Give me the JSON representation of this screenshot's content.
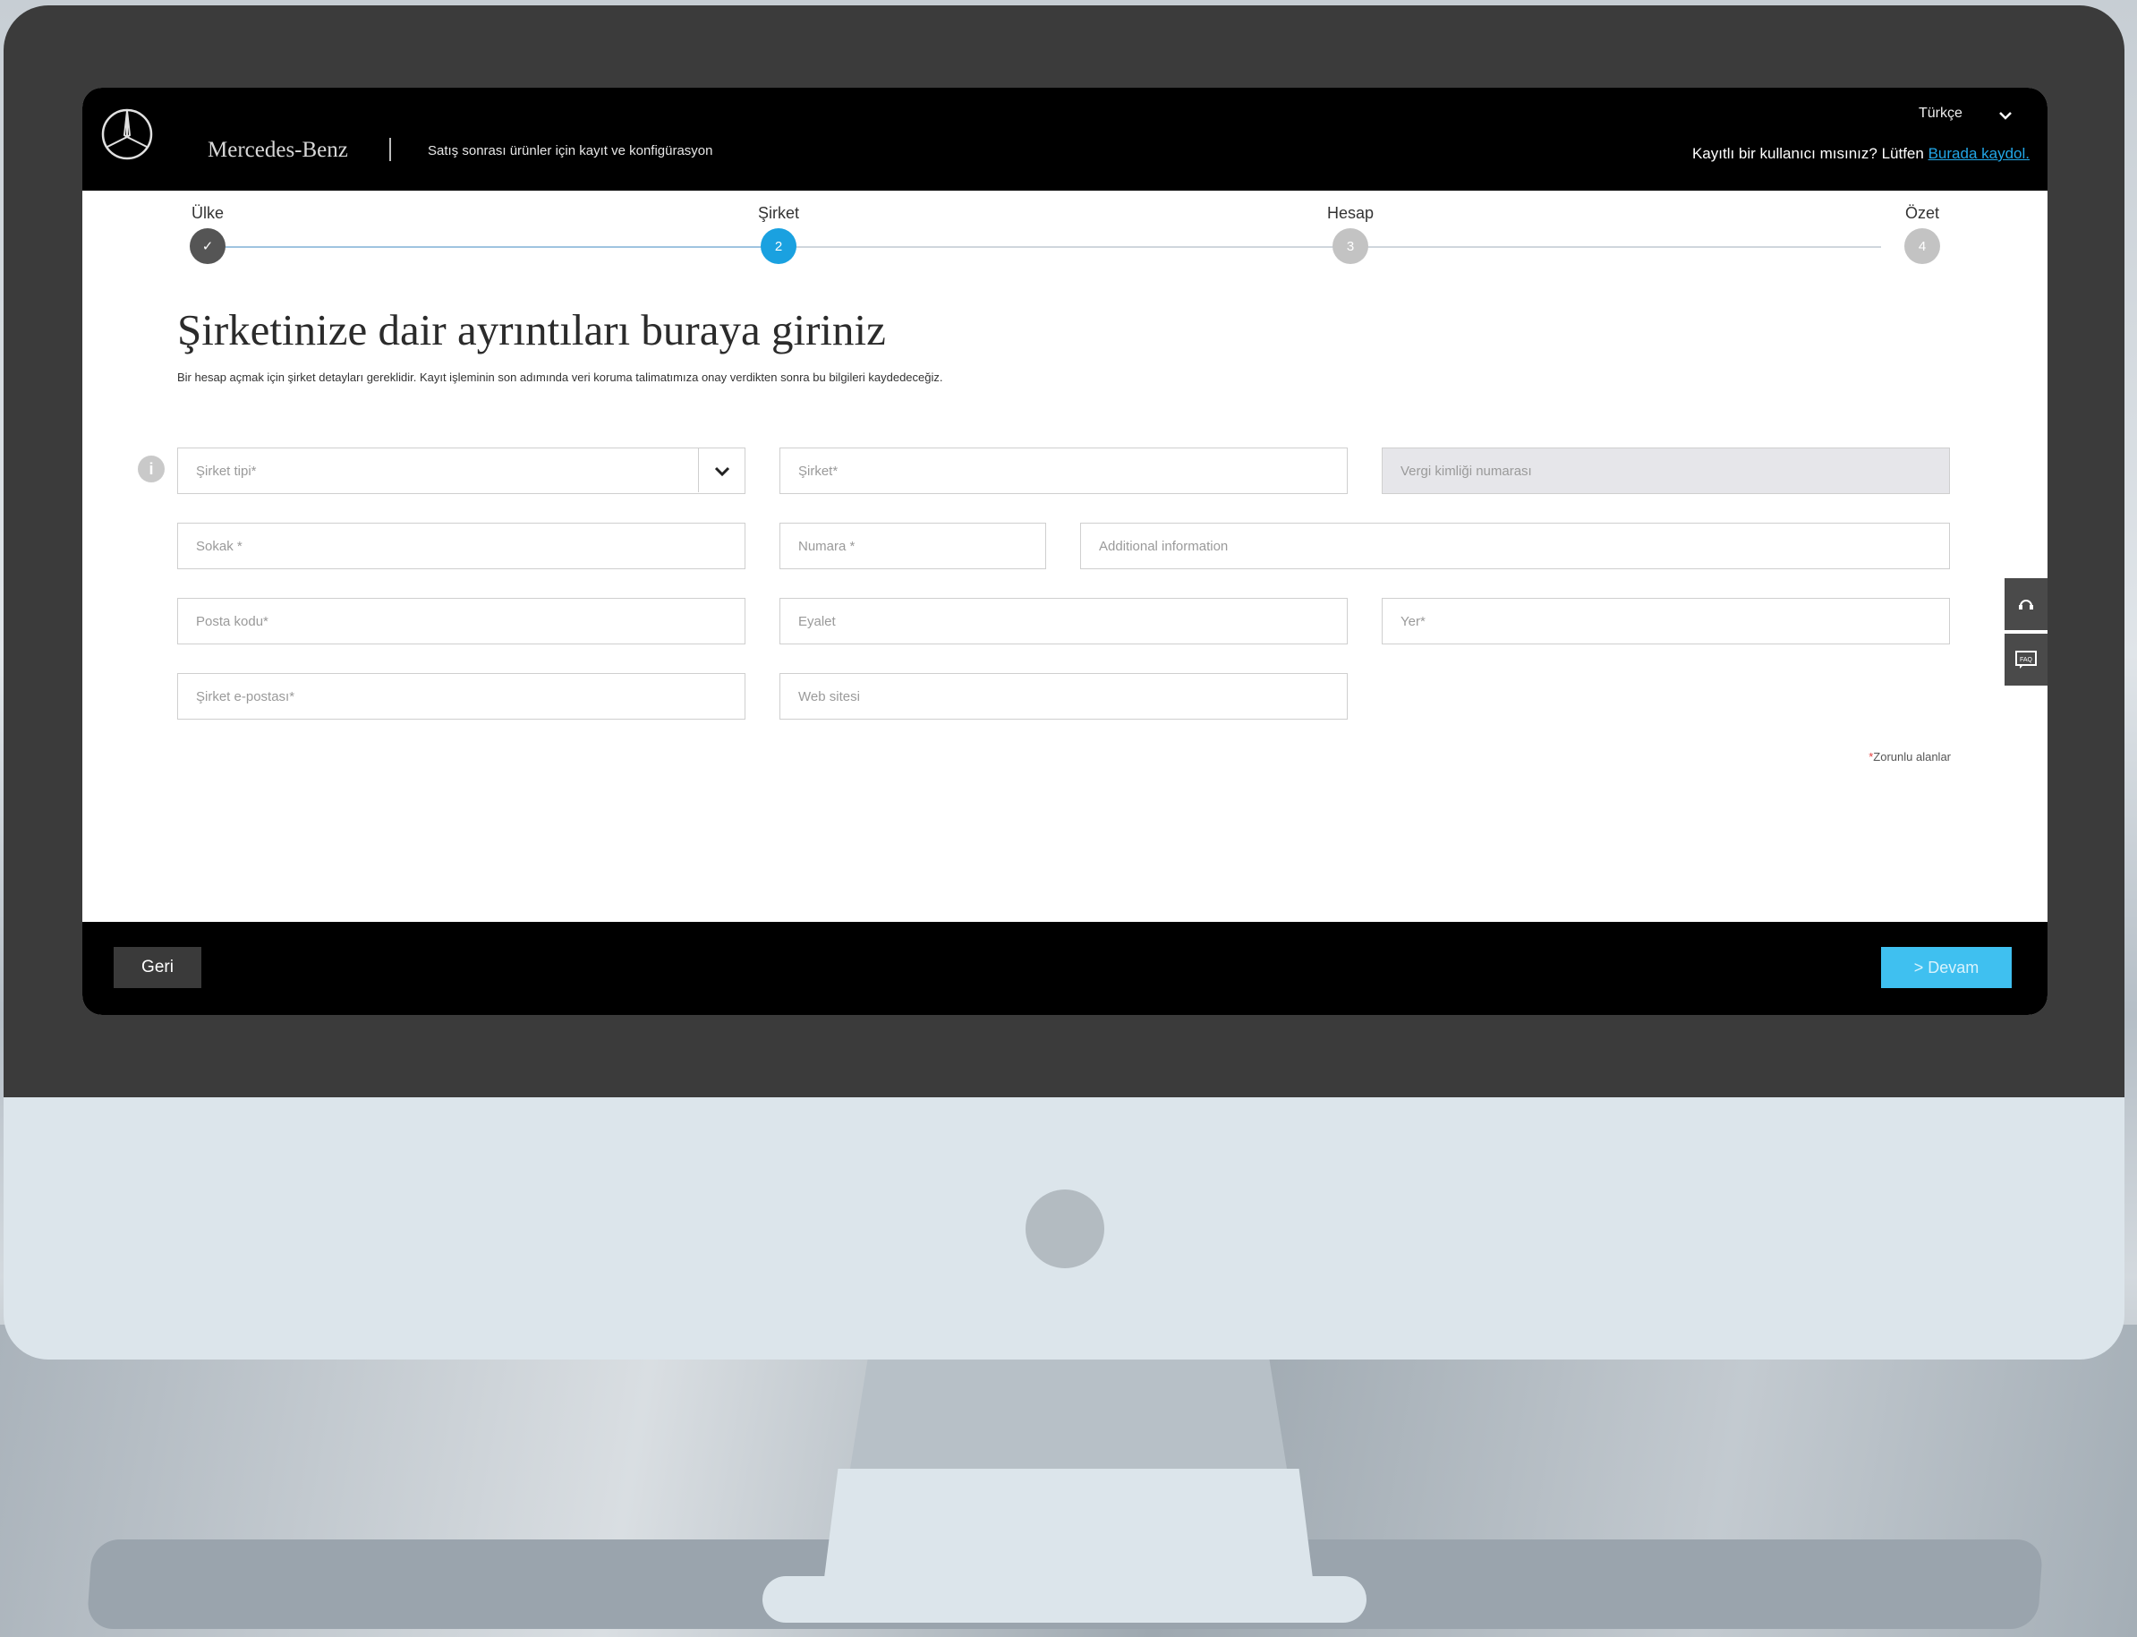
{
  "header": {
    "brand": "Mercedes-Benz",
    "subtitle": "Satış sonrası ürünler için kayıt ve konfigürasyon",
    "language": "Türkçe",
    "register_prompt": "Kayıtlı bir kullanıcı mısınız? Lütfen",
    "register_link": "Burada kaydol."
  },
  "stepper": {
    "steps": [
      {
        "label": "Ülke",
        "marker": "✓",
        "state": "done"
      },
      {
        "label": "Şirket",
        "marker": "2",
        "state": "active"
      },
      {
        "label": "Hesap",
        "marker": "3",
        "state": "todo"
      },
      {
        "label": "Özet",
        "marker": "4",
        "state": "todo"
      }
    ]
  },
  "main": {
    "title": "Şirketinize dair ayrıntıları buraya giriniz",
    "description": "Bir hesap açmak için şirket detayları gereklidir. Kayıt işleminin son adımında veri koruma talimatımıza onay verdikten sonra bu bilgileri kaydedeceğiz.",
    "info_icon": "i"
  },
  "form": {
    "company_type": {
      "placeholder": "Şirket tipi*",
      "value": ""
    },
    "company": {
      "placeholder": "Şirket*",
      "value": ""
    },
    "tax_id": {
      "placeholder": "Vergi kimliği numarası",
      "value": ""
    },
    "street": {
      "placeholder": "Sokak *",
      "value": ""
    },
    "number": {
      "placeholder": "Numara *",
      "value": ""
    },
    "additional": {
      "placeholder": "Additional information",
      "value": ""
    },
    "postal_code": {
      "placeholder": "Posta kodu*",
      "value": ""
    },
    "state": {
      "placeholder": "Eyalet",
      "value": ""
    },
    "city": {
      "placeholder": "Yer*",
      "value": ""
    },
    "email": {
      "placeholder": "Şirket e-postası*",
      "value": ""
    },
    "website": {
      "placeholder": "Web sitesi",
      "value": ""
    },
    "required_note_star": "*",
    "required_note": "Zorunlu alanlar"
  },
  "side_tabs": {
    "faq_label": "FAQ"
  },
  "footer": {
    "back_label": "Geri",
    "next_label": "> Devam"
  },
  "colors": {
    "accent": "#1aa1e0",
    "next_button": "#3fc0f0",
    "topbar": "#000000",
    "bezel": "#3b3b3b"
  },
  "icons": [
    "mercedes-star-icon",
    "chevron-down-icon",
    "check-icon",
    "info-icon",
    "headset-icon",
    "faq-icon"
  ]
}
